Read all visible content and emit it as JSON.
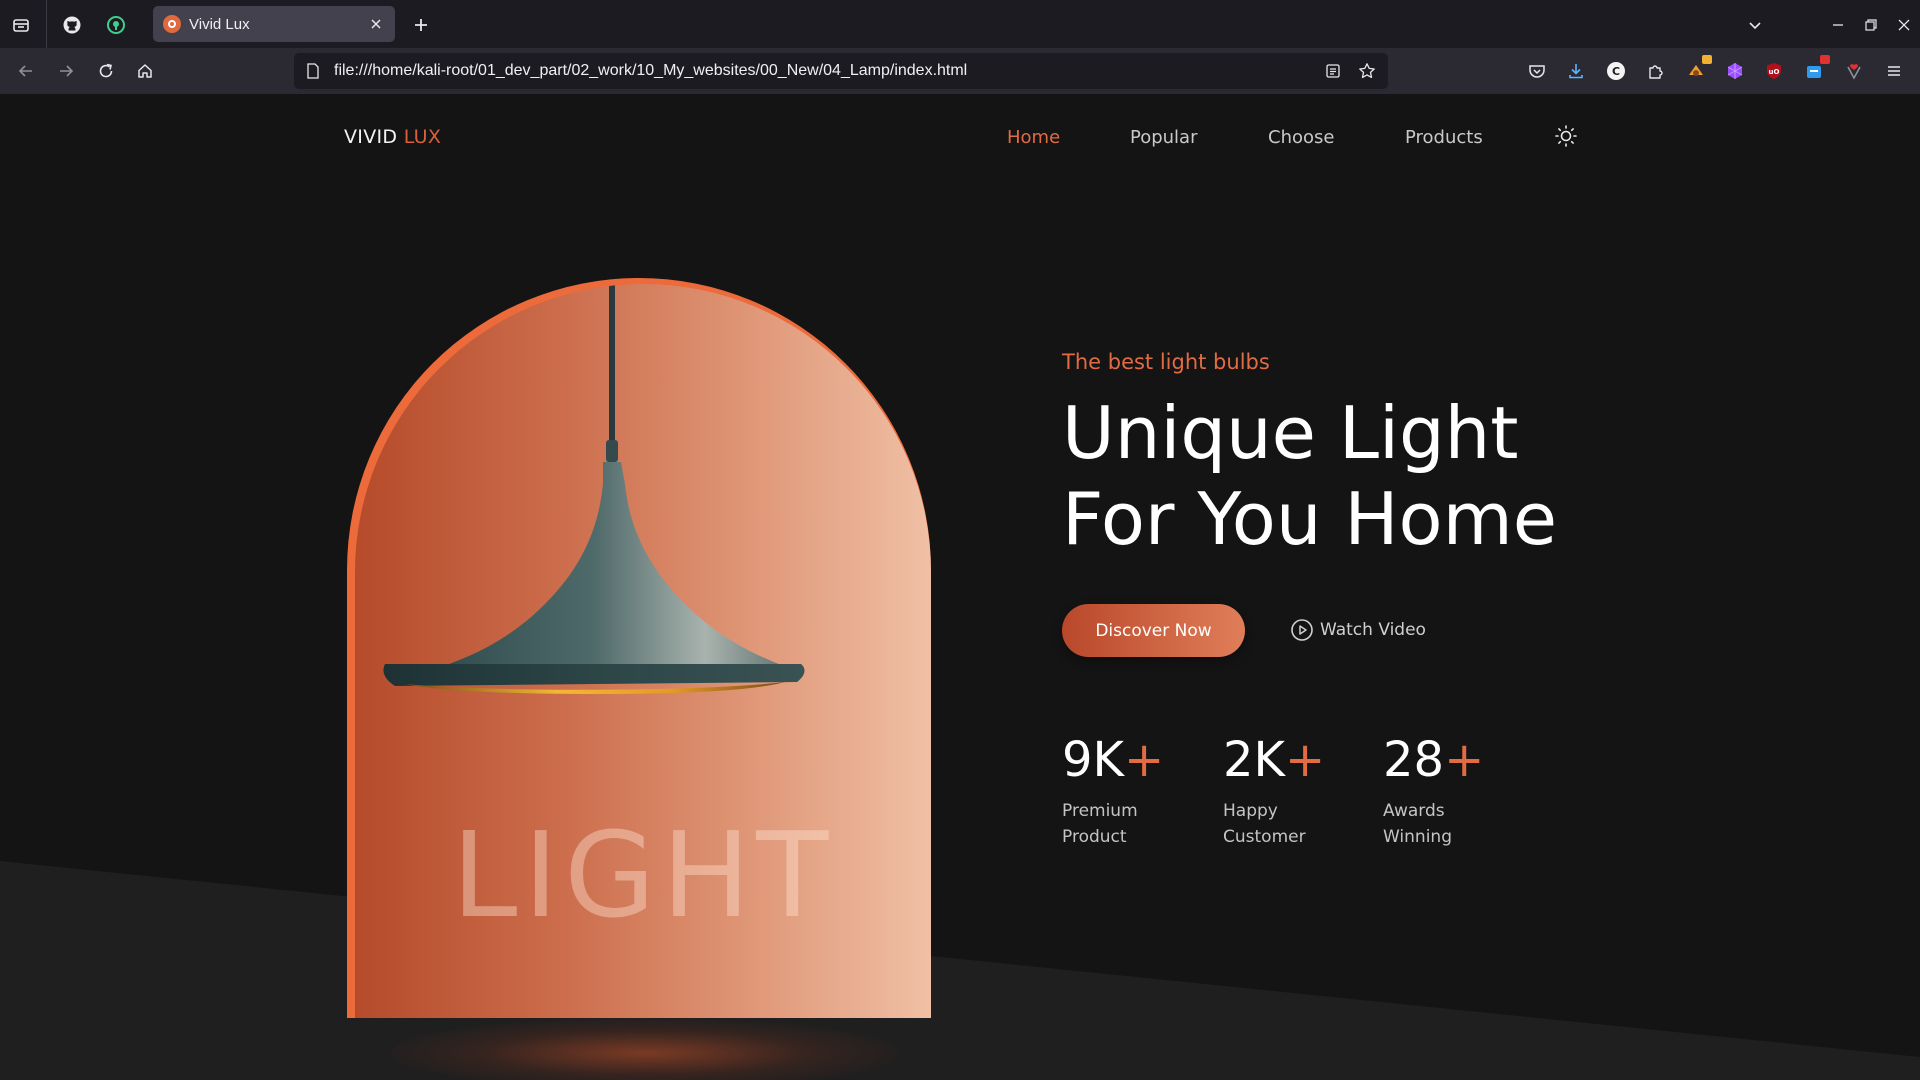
{
  "browser": {
    "tab": {
      "title": "Vivid Lux"
    },
    "url": "file:///home/kali-root/01_dev_part/02_work/10_My_websites/00_New/04_Lamp/index.html",
    "colors": {
      "tabbar": "#1c1b22",
      "navbar": "#2b2a33",
      "active_tab": "#42414d"
    },
    "toolbar_icons": [
      "tab-overview-icon",
      "github-icon",
      "extension-green-icon",
      "new-tab-icon",
      "list-all-tabs-icon",
      "minimize-icon",
      "restore-icon",
      "close-window-icon",
      "back-icon",
      "forward-icon",
      "reload-icon",
      "home-icon",
      "reader-view-icon",
      "bookmark-star-icon",
      "pocket-icon",
      "download-icon",
      "extension-c-icon",
      "extensions-puzzle-icon",
      "hamburger-menu-icon"
    ]
  },
  "site": {
    "logo": {
      "main": "VIVID ",
      "accent": "LUX"
    },
    "nav": [
      {
        "label": "Home",
        "active": true
      },
      {
        "label": "Popular",
        "active": false
      },
      {
        "label": "Choose",
        "active": false
      },
      {
        "label": "Products",
        "active": false
      }
    ],
    "theme_toggle_icon": "sun-icon",
    "hero": {
      "subtitle": "The best light bulbs",
      "headline_line1": "Unique Light",
      "headline_line2": "For You Home",
      "primary_button": "Discover Now",
      "secondary_button": "Watch Video",
      "image_word": "LIGHT"
    },
    "stats": [
      {
        "number": "9K",
        "plus": "+",
        "line1": "Premium",
        "line2": "Product"
      },
      {
        "number": "2K",
        "plus": "+",
        "line1": "Happy",
        "line2": "Customer"
      },
      {
        "number": "28",
        "plus": "+",
        "line1": "Awards",
        "line2": "Winning"
      }
    ],
    "colors": {
      "accent": "#e16c43",
      "background": "#141414",
      "floor": "#1f1f1f",
      "arch_border": "#ed6a3a"
    }
  }
}
